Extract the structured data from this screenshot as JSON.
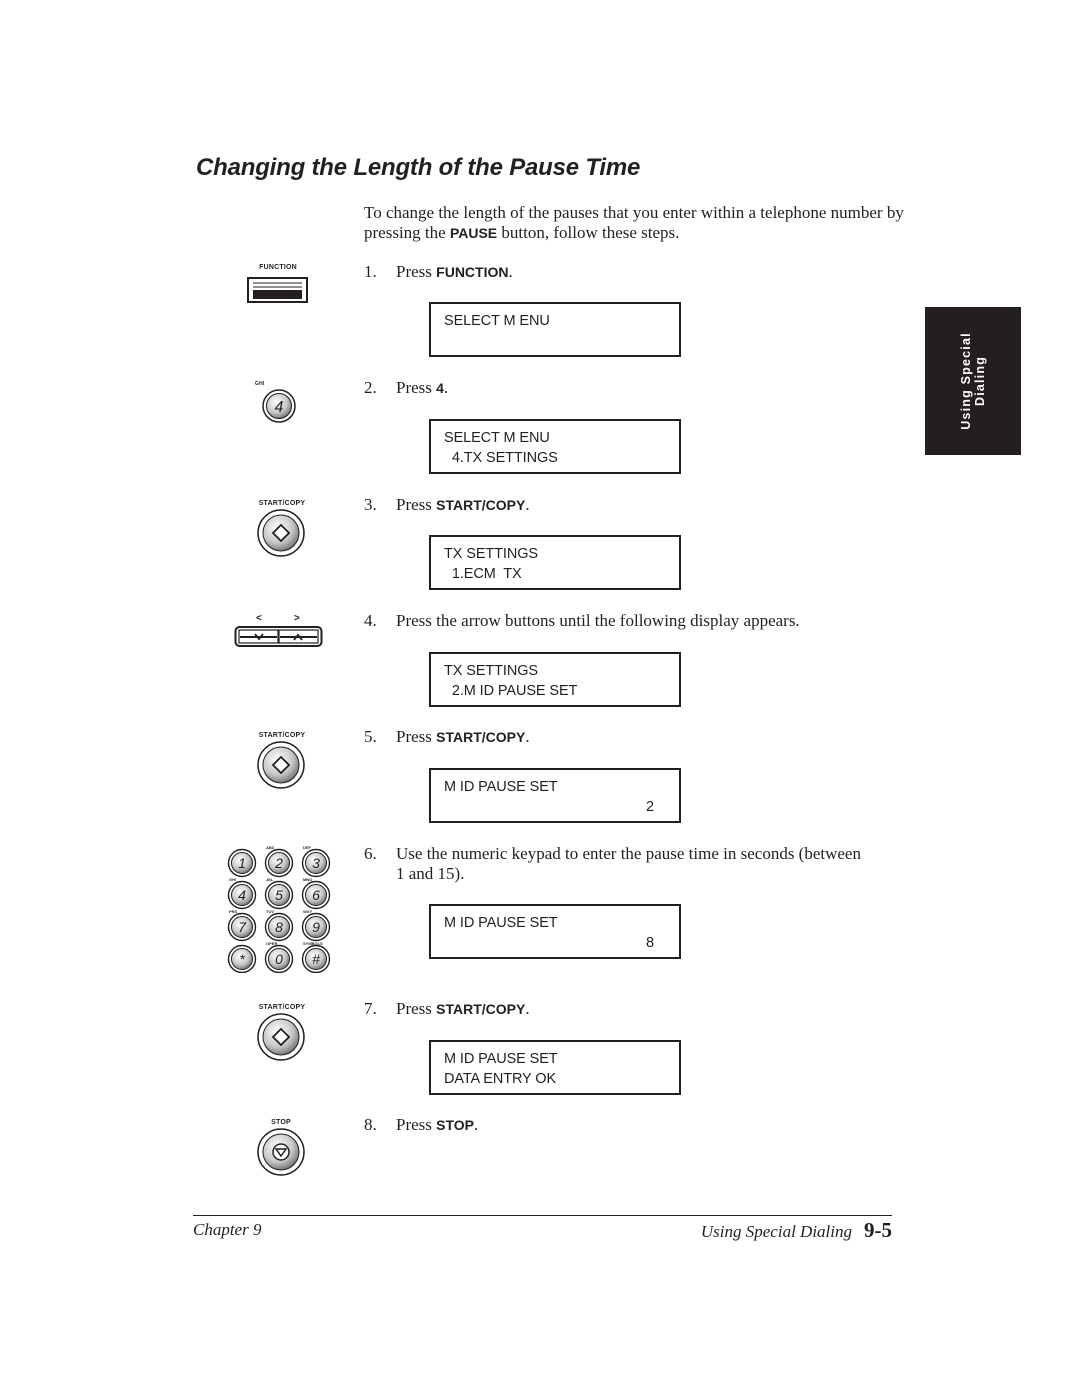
{
  "page": {
    "title": "Changing the Length of the Pause Time",
    "intro": {
      "before": "To change the length of the pauses that you enter within a telephone number by pressing the ",
      "bold": "PAUSE",
      "after": " button, follow these steps."
    },
    "steps": [
      {
        "number": "1.",
        "prefix": "Press ",
        "bold": "FUNCTION",
        "suffix": ".",
        "icon": "function-button-icon",
        "icon_label": "FUNCTION",
        "display": [
          "SELECT M ENU",
          ""
        ]
      },
      {
        "number": "2.",
        "prefix": "Press ",
        "bold": "4",
        "suffix": ".",
        "icon": "keypad-4-button-icon",
        "icon_label": "GHI",
        "display": [
          "SELECT M ENU",
          "  4.TX SETTINGS"
        ]
      },
      {
        "number": "3.",
        "prefix": "Press ",
        "bold": "START/COPY",
        "suffix": ".",
        "icon": "start-copy-button-icon",
        "icon_label": "START/COPY",
        "display": [
          "TX SETTINGS",
          "  1.ECM  TX"
        ]
      },
      {
        "number": "4.",
        "prefix": "Press the arrow buttons until the following display appears.",
        "bold": "",
        "suffix": "",
        "icon": "arrow-buttons-icon",
        "icon_label_left": "<",
        "icon_label_right": ">",
        "display": [
          "TX SETTINGS",
          "  2.M ID PAUSE SET"
        ]
      },
      {
        "number": "5.",
        "prefix": "Press ",
        "bold": "START/COPY",
        "suffix": ".",
        "icon": "start-copy-button-icon",
        "icon_label": "START/COPY",
        "display": [
          "M ID PAUSE SET",
          "2"
        ]
      },
      {
        "number": "6.",
        "prefix": "Use the numeric keypad to enter the pause time in seconds (between 1 and 15).",
        "bold": "",
        "suffix": "",
        "icon": "numeric-keypad-icon",
        "display": [
          "M ID PAUSE SET",
          "8"
        ]
      },
      {
        "number": "7.",
        "prefix": "Press ",
        "bold": "START/COPY",
        "suffix": ".",
        "icon": "start-copy-button-icon",
        "icon_label": "START/COPY",
        "display": [
          "M ID PAUSE SET",
          "DATA ENTRY OK"
        ]
      },
      {
        "number": "8.",
        "prefix": "Press ",
        "bold": "STOP",
        "suffix": ".",
        "icon": "stop-button-icon",
        "icon_label": "STOP"
      }
    ],
    "keypad": {
      "keys": [
        "1",
        "2",
        "3",
        "4",
        "5",
        "6",
        "7",
        "8",
        "9",
        "*",
        "0",
        "#"
      ],
      "key_labels": [
        "",
        "ABC",
        "DEF",
        "GHI",
        "JKL",
        "MNO",
        "PRS",
        "TUV",
        "WXY",
        "",
        "OPER",
        "SYMBOLS"
      ]
    },
    "side_tab": {
      "line1": "Using Special",
      "line2": "Dialing"
    },
    "footer": {
      "chapter": "Chapter 9",
      "section": "Using Special Dialing",
      "page_number": "9-5"
    }
  }
}
